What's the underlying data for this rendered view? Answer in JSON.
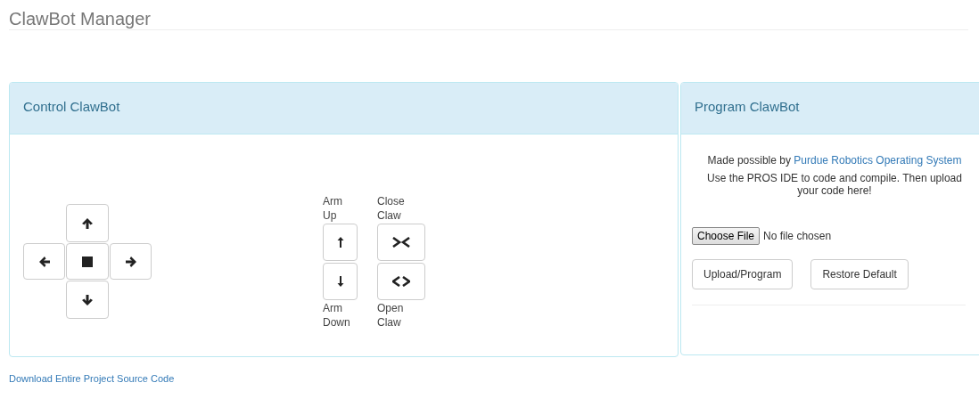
{
  "page_title": "ClawBot Manager",
  "control_panel": {
    "title": "Control ClawBot",
    "arm_controls": [
      {
        "kind": "arm",
        "top_label": "Arm Up",
        "bottom_label": "Arm Down"
      },
      {
        "kind": "claw",
        "top_label": "Close Claw",
        "bottom_label": "Open Claw"
      }
    ]
  },
  "program_panel": {
    "title": "Program ClawBot",
    "credit_text": "Made possible by",
    "credit_link": "Purdue Robotics Operating System",
    "instructions": "Use the PROS IDE to code and compile. Then upload your code here!",
    "file_button": "Choose File",
    "file_status": "No file chosen",
    "buttons": [
      "Upload/Program",
      "Restore Default"
    ]
  },
  "footer_link": "Download Entire Project Source Code"
}
